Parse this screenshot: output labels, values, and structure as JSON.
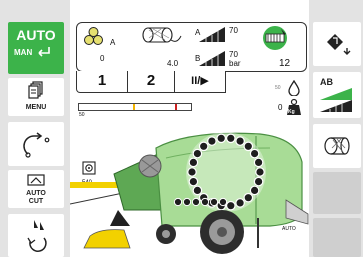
{
  "mode": {
    "auto_label": "AUTO",
    "manual_label": "MAN"
  },
  "left_buttons": {
    "menu_label": "MENU",
    "auto_cut_line1": "AUTO",
    "auto_cut_line2": "CUT"
  },
  "info_panel": {
    "bale_label": "A",
    "bale_count": "0",
    "net_length": "4.0",
    "pressure_a_label": "A",
    "pressure_a_value": "70",
    "pressure_b_label": "B",
    "pressure_b_value": "70",
    "pressure_b_unit": "bar",
    "knife_count": "12",
    "tabs": [
      "1",
      "2"
    ],
    "play_pause_label": "II/▶"
  },
  "gauges": {
    "bar_min_label": "50",
    "bar_fill_percent": 0,
    "drop_label": "50",
    "weight_value": "0",
    "weight_unit": "Kg"
  },
  "machine": {
    "pto_speed": "540",
    "chamber_label": "AUTO"
  },
  "right_buttons": {
    "ab_label": "AB"
  },
  "colors": {
    "brand_green": "#3cb34a",
    "machine_green": "#8dcf7a",
    "accent_yellow": "#f2d100",
    "indicator_red": "#cc2222"
  }
}
